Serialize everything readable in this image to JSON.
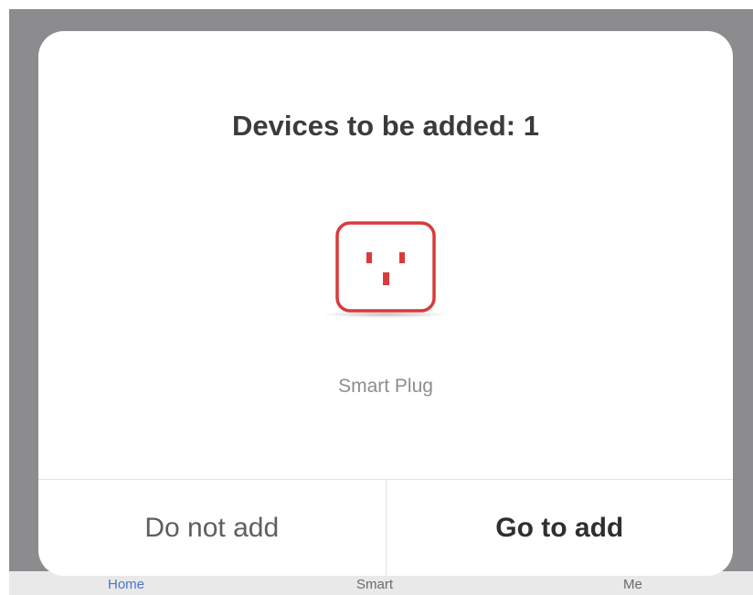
{
  "dialog": {
    "title": "Devices to be added: 1",
    "device": {
      "name": "Smart Plug",
      "icon": "smart-plug-icon",
      "accent_color": "#d93a3a"
    },
    "buttons": {
      "cancel_label": "Do not add",
      "confirm_label": "Go to add"
    }
  },
  "tabbar": {
    "tabs": [
      {
        "label": "Home",
        "active": true
      },
      {
        "label": "Smart",
        "active": false
      },
      {
        "label": "Me",
        "active": false
      }
    ]
  }
}
